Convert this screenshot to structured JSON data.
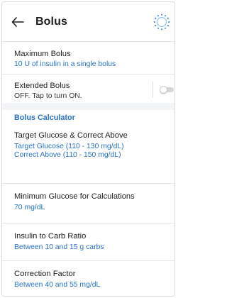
{
  "header": {
    "title": "Bolus"
  },
  "settings": {
    "maximum_bolus": {
      "label": "Maximum Bolus",
      "value": "10 U of insulin in a single bolus"
    },
    "extended_bolus": {
      "label": "Extended Bolus",
      "value": "OFF. Tap to turn ON.",
      "enabled": false
    }
  },
  "bolus_calculator": {
    "header": "Bolus Calculator",
    "target_glucose": {
      "label": "Target Glucose & Correct Above",
      "line1": "Target Glucose (110 - 130 mg/dL)",
      "line2": "Correct Above (110 - 150 mg/dL)"
    },
    "minimum_glucose": {
      "label": "Minimum Glucose for Calculations",
      "value": "70 mg/dL"
    },
    "insulin_to_carb": {
      "label": "Insulin to Carb Ratio",
      "value": "Between 10 and 15 g carbs"
    },
    "correction_factor": {
      "label": "Correction Factor",
      "value": "Between 40 and 55 mg/dL"
    }
  },
  "colors": {
    "accent": "#2a72c9",
    "toggle_off": "#d4d6d8"
  }
}
